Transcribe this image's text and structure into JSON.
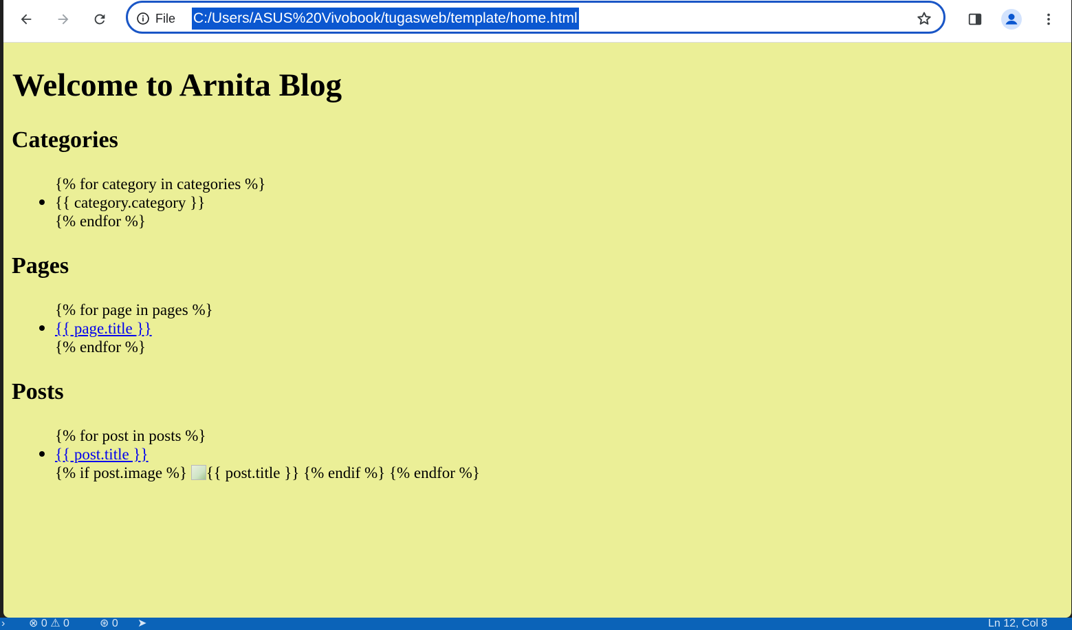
{
  "toolbar": {
    "back_icon": "arrow-left-icon",
    "forward_icon": "arrow-right-icon",
    "reload_icon": "reload-icon",
    "site_info_label": "File",
    "url": "C:/Users/ASUS%20Vivobook/tugasweb/template/home.html",
    "accent_color": "#1a56c6"
  },
  "page": {
    "background": "#ebef97",
    "title": "Welcome to Arnita Blog",
    "categories": {
      "heading": "Categories",
      "loop_start": "{% for category in categories %}",
      "item": "{{ category.category }}",
      "loop_end": "{% endfor %}"
    },
    "pages": {
      "heading": "Pages",
      "loop_start": "{% for page in pages %}",
      "item_link": "{{ page.title }}",
      "loop_end": "{% endfor %}"
    },
    "posts": {
      "heading": "Posts",
      "loop_start": "{% for post in posts %}",
      "item_link": "{{ post.title }}",
      "if_start": "{% if post.image %}",
      "img_alt": "{{ post.title }}",
      "if_end": "{% endif %}",
      "loop_end": "{% endfor %}"
    }
  },
  "statusbar": {
    "errors": "0",
    "warnings": "0",
    "ports": "0",
    "cursor": "Ln 12, Col 8"
  }
}
